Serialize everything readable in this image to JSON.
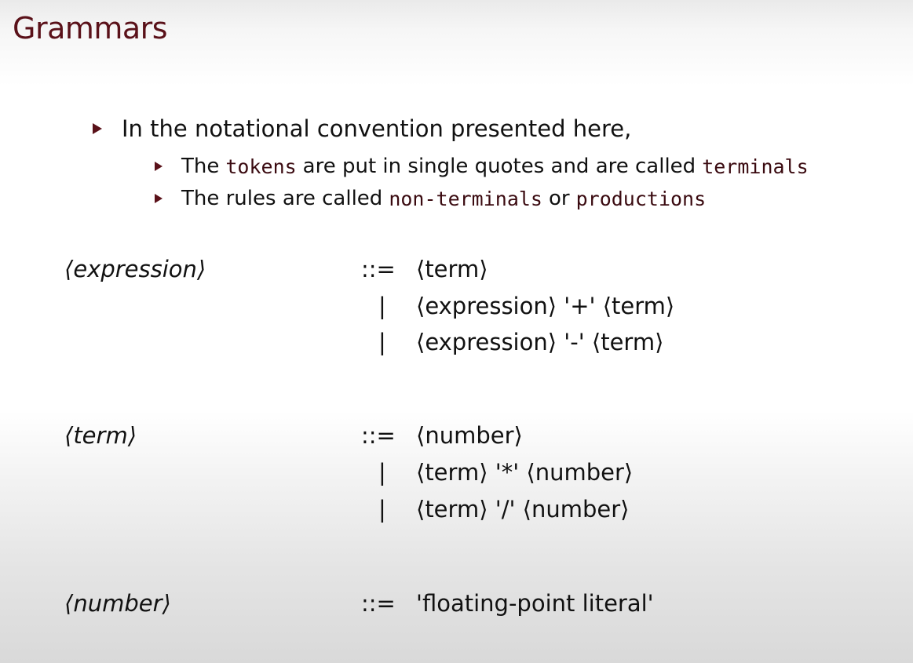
{
  "title": "Grammars",
  "bullets": {
    "main": "In the notational convention presented here,",
    "sub1": {
      "pre": "The",
      "kw1": "tokens",
      "mid": "are put in single quotes and are called",
      "kw2": "terminals"
    },
    "sub2": {
      "pre": "The rules are called",
      "kw1": "non-terminals",
      "mid": "or",
      "kw2": "productions"
    }
  },
  "grammar": {
    "expression": {
      "name": "⟨expression⟩",
      "op": "::=",
      "alt1": "⟨term⟩",
      "alt2": "⟨expression⟩ '+' ⟨term⟩",
      "alt3": "⟨expression⟩ '-' ⟨term⟩"
    },
    "term": {
      "name": "⟨term⟩",
      "op": "::=",
      "alt1": "⟨number⟩",
      "alt2": "⟨term⟩ '*' ⟨number⟩",
      "alt3": "⟨term⟩ '/' ⟨number⟩"
    },
    "number": {
      "name": "⟨number⟩",
      "op": "::=",
      "alt1": "'floating-point literal'"
    },
    "separator": "|"
  }
}
